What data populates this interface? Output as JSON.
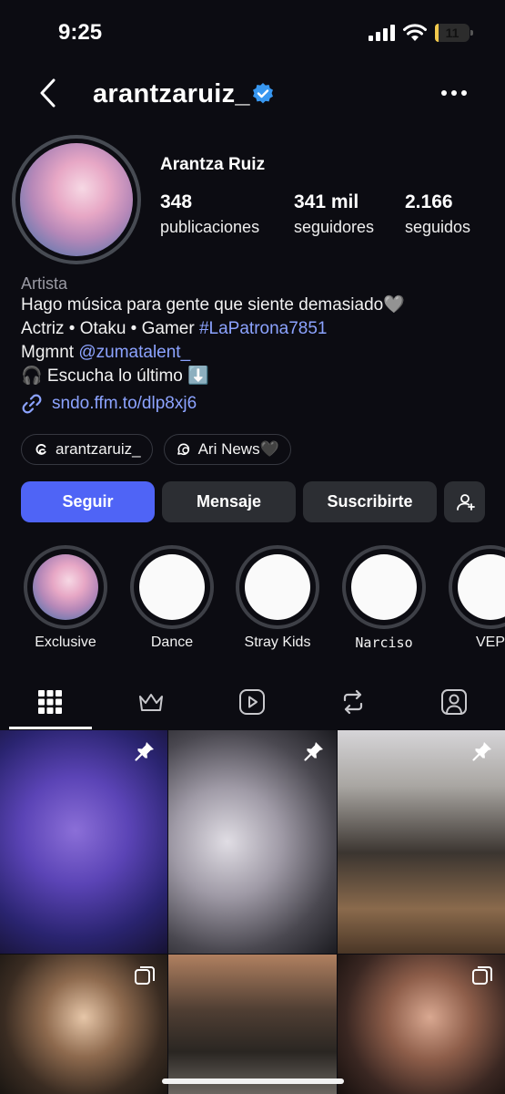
{
  "status_bar": {
    "time": "9:25",
    "battery_level": "11"
  },
  "header": {
    "username": "arantzaruiz_"
  },
  "profile": {
    "full_name": "Arantza Ruiz",
    "stats": [
      {
        "value": "348",
        "label": "publicaciones"
      },
      {
        "value": "341 mil",
        "label": "seguidores"
      },
      {
        "value": "2.166",
        "label": "seguidos"
      }
    ],
    "category": "Artista",
    "bio_line1": "Hago música para gente que siente demasiado🩶",
    "bio_line2_prefix": "Actriz • Otaku • Gamer ",
    "bio_line2_hashtag": "#LaPatrona7851",
    "bio_line3_prefix": "Mgmnt ",
    "bio_line3_mention": "@zumatalent_",
    "bio_line4": "🎧 Escucha lo último ⬇️",
    "url": "sndo.ffm.to/dlp8xj6"
  },
  "chips": [
    {
      "label": "arantzaruiz_",
      "icon": "threads-icon"
    },
    {
      "label": "Ari News🖤",
      "icon": "channel-icon"
    }
  ],
  "buttons": {
    "follow": "Seguir",
    "message": "Mensaje",
    "subscribe": "Suscribirte"
  },
  "highlights": [
    {
      "label": "Exclusive"
    },
    {
      "label": "Dance"
    },
    {
      "label": "Stray Kids"
    },
    {
      "label": "Narciso"
    },
    {
      "label": "VEP"
    }
  ],
  "tabs": [
    "grid-icon",
    "crown-icon",
    "reels-icon",
    "reposts-icon",
    "tagged-icon"
  ],
  "colors": {
    "accent": "#4f64f6",
    "link": "#8ca3ff",
    "background": "#0c0c12"
  }
}
